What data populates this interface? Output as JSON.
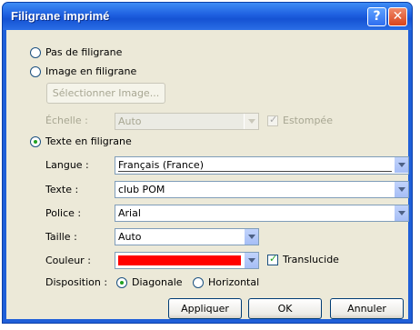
{
  "window": {
    "title": "Filigrane imprimé",
    "help_glyph": "?",
    "close_glyph": "✕"
  },
  "options": {
    "no_watermark": "Pas de filigrane",
    "image_watermark": "Image en filigrane",
    "text_watermark": "Texte en filigrane"
  },
  "image_section": {
    "select_button": "Sélectionner Image...",
    "scale_label": "Échelle :",
    "scale_value": "Auto",
    "washout_label": "Estompée"
  },
  "text_section": {
    "language_label": "Langue :",
    "language_value": "Français (France)",
    "text_label": "Texte :",
    "text_value": "club POM",
    "font_label": "Police :",
    "font_value": "Arial",
    "size_label": "Taille :",
    "size_value": "Auto",
    "color_label": "Couleur :",
    "color_value": "#ff0000",
    "translucent_label": "Translucide",
    "layout_label": "Disposition :",
    "layout_diagonal": "Diagonale",
    "layout_horizontal": "Horizontal"
  },
  "buttons": {
    "apply": "Appliquer",
    "ok": "OK",
    "cancel": "Annuler"
  }
}
